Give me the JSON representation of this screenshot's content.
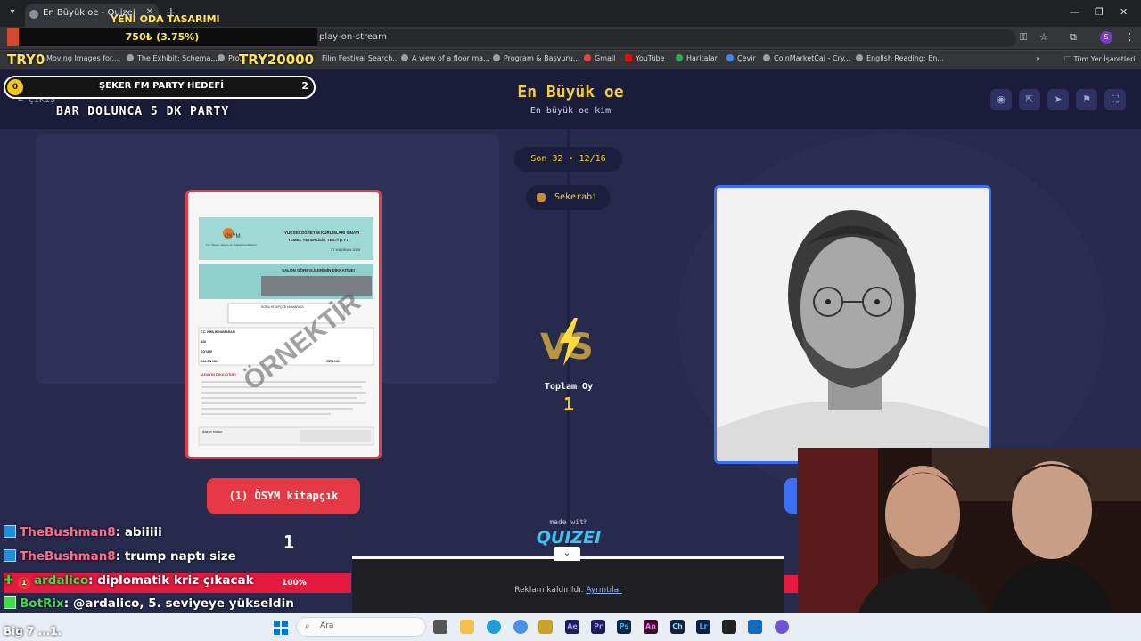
{
  "browser": {
    "tab_title": "En Büyük oe - Quizei",
    "url_fragment": "play-on-stream",
    "bookmarks": [
      "Moving Images for...",
      "The Exhibit: Schema...",
      "Pro...",
      "Film Festival Search...",
      "A view of a floor ma...",
      "Program & Başvuru...",
      "Gmail",
      "YouTube",
      "Haritalar",
      "Çevir",
      "CoinMarketCal - Cry...",
      "English Reading: En..."
    ],
    "all_bookmarks": "Tüm Yer İşaretleri",
    "profile_initial": "S"
  },
  "stream_goal": {
    "label": "YENİ ODA TASARIMI",
    "progress_text": "750₺ (3.75%)",
    "progress_fraction": 0.0375,
    "min": "TRY0",
    "max": "TRY20000"
  },
  "party": {
    "coin": "0",
    "title": "ŞEKER FM PARTY HEDEFİ",
    "count": "2",
    "caption": "BAR DOLUNCA 5 DK PARTY"
  },
  "quiz": {
    "back": "ÇIKIŞ",
    "title": "En Büyük oe",
    "subtitle": "En büyük oe kim",
    "round": "Son 32 • 12/16",
    "user": "Sekerabi",
    "total_label": "Toplam Oy",
    "total_value": "1",
    "left_option": "(1) ÖSYM kitapçık",
    "left_votes": "1",
    "made_with": "made with",
    "brand": "QUIZEI"
  },
  "exam_sheet": {
    "logo": "ÖSYM",
    "org_line": "T.C. Ölçme, Seçme ve Yerleştirme Merkezi",
    "title_line1": "YÜKSEKÖĞRETİM KURUMLARI SINAVI",
    "title_line2": "TEMEL YETERLİLİK TESTİ (TYT)",
    "date": "27 HAZİRAN 2020",
    "notice": "SALON GÖREVLİLERİNİN DİKKATİNE!",
    "booklet_no": "SORU KİTAPÇIĞI NUMARASI",
    "fields": [
      "T.C. KİMLİK NUMARASI",
      "ADI",
      "SOYADI",
      "SALON NO.",
      "SIRA NO."
    ],
    "watermark": "ÖRNEKTİR",
    "instructions_title": "ADAYIN DİKKATİNE!",
    "signature_label": "Adayın imzası:"
  },
  "ad": {
    "text": "Reklam kaldırıldı.",
    "link": "Ayrıntılar"
  },
  "chat": [
    {
      "user": "TheBushman8",
      "msg": ": abiiiii"
    },
    {
      "user": "TheBushman8",
      "msg": ": trump naptı size"
    },
    {
      "user": "ardalico",
      "msg": ": diplomatik kriz çıkacak",
      "badge": "1"
    },
    {
      "user": "BotRix",
      "msg": ": @ardalico, 5. seviyeye yükseldin"
    }
  ],
  "chat_percent": "100%",
  "weather": "Big 7 ...1.",
  "taskbar": {
    "search_placeholder": "Ara",
    "apps": [
      "Ae",
      "Pr",
      "Ps",
      "An",
      "Ch",
      "Lr"
    ]
  },
  "colors": {
    "accent_gold": "#f2cf3a",
    "vote_red": "#e63946",
    "vote_blue": "#3d6ff2",
    "page_bg": "#272a4c"
  }
}
